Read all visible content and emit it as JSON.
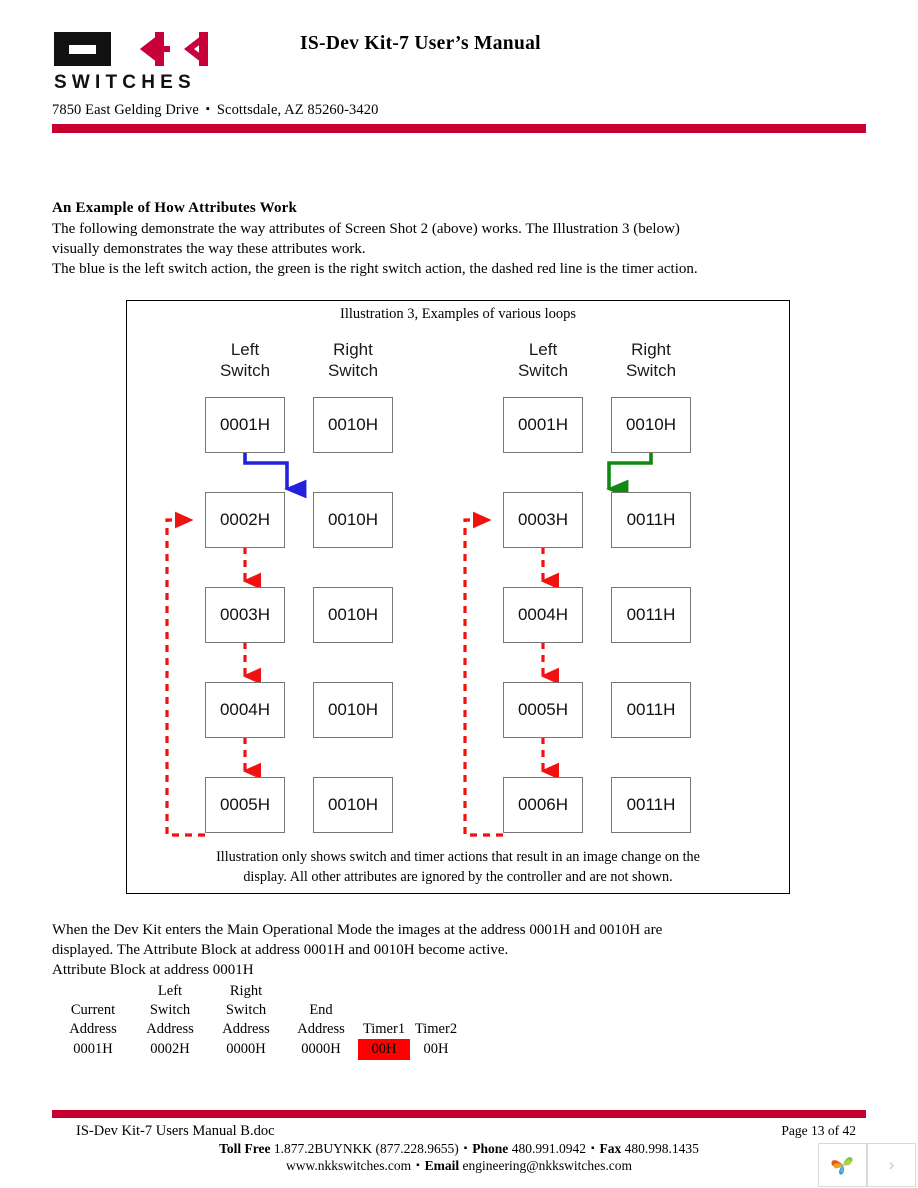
{
  "header": {
    "logo_name": "NKK SWITCHES",
    "logo_wordmark": "SWITCHES",
    "title": "IS-Dev Kit-7 User’s Manual",
    "address_street": "7850 East Gelding Drive",
    "address_separator": "▪",
    "address_city": "Scottsdale, AZ  85260-3420",
    "accent_color": "#c8002f"
  },
  "body": {
    "section_heading": "An Example of How Attributes Work",
    "intro_lines": [
      "The following demonstrate the way attributes of Screen Shot 2 (above) works. The Illustration 3 (below)",
      "visually demonstrates the way these attributes work.",
      "The blue is the left switch action, the green is the right switch action, the dashed red line is the timer action."
    ],
    "post_lines": [
      "When the Dev Kit enters the Main Operational Mode the images at the address 0001H and 0010H are",
      "displayed. The Attribute Block at address 0001H and 0010H become active.",
      "Attribute Block at address 0001H"
    ]
  },
  "illustration": {
    "title": "Illustration 3, Examples of various loops",
    "caption_lines": [
      "Illustration only shows switch and timer actions that result in an image change on the",
      "display. All other attributes are ignored by the controller and are not shown."
    ],
    "colors": {
      "left_switch_arrow": "#2222dd",
      "right_switch_arrow": "#118811",
      "timer_arrow": "#f21111",
      "box_border": "#777777"
    },
    "column_headers": [
      {
        "line1": "Left",
        "line2": "Switch"
      },
      {
        "line1": "Right",
        "line2": "Switch"
      },
      {
        "line1": "Left",
        "line2": "Switch"
      },
      {
        "line1": "Right",
        "line2": "Switch"
      }
    ],
    "groups": [
      {
        "name": "left-group",
        "left_column": [
          "0001H",
          "0002H",
          "0003H",
          "0004H",
          "0005H"
        ],
        "right_column": [
          "0010H",
          "0010H",
          "0010H",
          "0010H",
          "0010H"
        ]
      },
      {
        "name": "right-group",
        "left_column": [
          "0001H",
          "0003H",
          "0004H",
          "0005H",
          "0006H"
        ],
        "right_column": [
          "0010H",
          "0011H",
          "0011H",
          "0011H",
          "0011H"
        ]
      }
    ]
  },
  "attribute_table": {
    "header_row_1": [
      "",
      "Left",
      "Right",
      "",
      "",
      ""
    ],
    "header_row_2": [
      "Current",
      "Switch",
      "Switch",
      "End",
      "",
      ""
    ],
    "header_row_3": [
      "Address",
      "Address",
      "Address",
      "Address",
      "Timer1",
      "Timer2"
    ],
    "value_row": [
      "0001H",
      "0002H",
      "0000H",
      "0000H",
      "00H",
      "00H"
    ],
    "highlight_color": "#ff0000",
    "highlighted_cell": "Timer1"
  },
  "footer": {
    "doc_name": "IS-Dev Kit-7 Users Manual B.doc",
    "page_number": "Page 13 of 42",
    "toll_free_label": "Toll Free",
    "toll_free_value": "1.877.2BUYNKK (877.228.9655)",
    "phone_label": "Phone",
    "phone_value": "480.991.0942",
    "fax_label": "Fax",
    "fax_value": "480.998.1435",
    "website": "www.nkkswitches.com",
    "email_label": "Email",
    "email_value": "engineering@nkkswitches.com",
    "separator": "▪"
  },
  "page_nav": {
    "leaf_icon": "leaf-logo-icon",
    "next_label": "›"
  }
}
